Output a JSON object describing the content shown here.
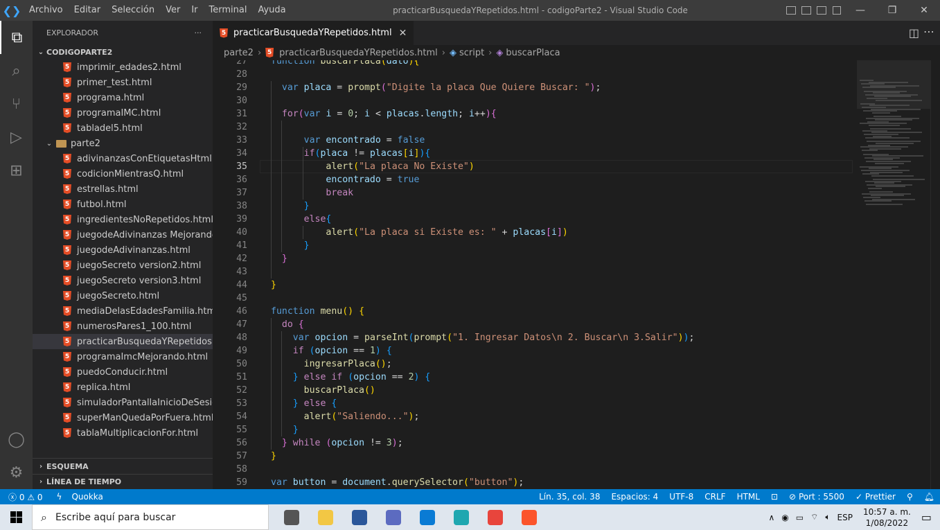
{
  "titlebar": {
    "menus": [
      "Archivo",
      "Editar",
      "Selección",
      "Ver",
      "Ir",
      "Terminal",
      "Ayuda"
    ],
    "title": "practicarBusquedaYRepetidos.html - codigoParte2 - Visual Studio Code",
    "minimize": "—",
    "restore": "❐",
    "close": "✕"
  },
  "activity": [
    {
      "name": "explorer-icon",
      "glyph": "⧉"
    },
    {
      "name": "search-icon",
      "glyph": "⌕"
    },
    {
      "name": "source-control-icon",
      "glyph": "⑂"
    },
    {
      "name": "run-debug-icon",
      "glyph": "▷"
    },
    {
      "name": "extensions-icon",
      "glyph": "⊞"
    }
  ],
  "activity_bottom": [
    {
      "name": "account-icon",
      "glyph": "◯"
    },
    {
      "name": "settings-gear-icon",
      "glyph": "⚙"
    }
  ],
  "sidebar": {
    "title": "EXPLORADOR",
    "more": "···",
    "root": "CODIGOPARTE2",
    "files_before": [
      "imprimir_edades2.html",
      "primer_test.html",
      "programa.html",
      "programaIMC.html",
      "tabladel5.html"
    ],
    "folder": "parte2",
    "files": [
      "adivinanzasConEtiquetasHtml.ht...",
      "codicionMientrasQ.html",
      "estrellas.html",
      "futbol.html",
      "ingredientesNoRepetidos.html",
      "juegodeAdivinanzas Mejorando....",
      "juegodeAdivinanzas.html",
      "juegoSecreto version2.html",
      "juegoSecreto version3.html",
      "juegoSecreto.html",
      "mediaDelasEdadesFamilia.html",
      "numerosPares1_100.html",
      "practicarBusquedaYRepetidos.ht...",
      "programaImcMejorando.html",
      "puedoConducir.html",
      "replica.html",
      "simuladorPantallaInicioDeSesion...",
      "superManQuedaPorFuera.html",
      "tablaMultiplicacionFor.html"
    ],
    "selected_index": 12,
    "outline": "ESQUEMA",
    "timeline": "LÍNEA DE TIEMPO"
  },
  "tab": {
    "label": "practicarBusquedaYRepetidos.html",
    "close": "✕"
  },
  "breadcrumb": {
    "folder": "parte2",
    "file": "practicarBusquedaYRepetidos.html",
    "symbol1": "script",
    "symbol2": "buscarPlaca"
  },
  "editor": {
    "first_line": 27,
    "current_line": 35,
    "lines": [
      [
        [
          "k",
          "function "
        ],
        [
          "f",
          "buscarPlaca"
        ],
        [
          "b1",
          "("
        ],
        [
          "v",
          "dato"
        ],
        [
          "b1",
          ")"
        ],
        [
          "b1",
          "{"
        ]
      ],
      [],
      [
        [
          "t",
          "  "
        ],
        [
          "k",
          "var "
        ],
        [
          "v",
          "placa"
        ],
        [
          "t",
          " = "
        ],
        [
          "f",
          "prompt"
        ],
        [
          "b2",
          "("
        ],
        [
          "s",
          "\"Digite la placa Que Quiere Buscar: \""
        ],
        [
          "b2",
          ")"
        ],
        [
          "t",
          ";"
        ]
      ],
      [],
      [
        [
          "t",
          "  "
        ],
        [
          "c",
          "for"
        ],
        [
          "b2",
          "("
        ],
        [
          "k",
          "var "
        ],
        [
          "v",
          "i"
        ],
        [
          "t",
          " = "
        ],
        [
          "n",
          "0"
        ],
        [
          "t",
          "; "
        ],
        [
          "v",
          "i"
        ],
        [
          "t",
          " < "
        ],
        [
          "v",
          "placas"
        ],
        [
          "t",
          "."
        ],
        [
          "v",
          "length"
        ],
        [
          "t",
          "; "
        ],
        [
          "v",
          "i"
        ],
        [
          "t",
          "++"
        ],
        [
          "b2",
          ")"
        ],
        [
          "b2",
          "{"
        ]
      ],
      [],
      [
        [
          "t",
          "      "
        ],
        [
          "k",
          "var "
        ],
        [
          "v",
          "encontrado"
        ],
        [
          "t",
          " = "
        ],
        [
          "k",
          "false"
        ]
      ],
      [
        [
          "t",
          "      "
        ],
        [
          "c",
          "if"
        ],
        [
          "b3",
          "("
        ],
        [
          "v",
          "placa"
        ],
        [
          "t",
          " != "
        ],
        [
          "v",
          "placas"
        ],
        [
          "b1",
          "["
        ],
        [
          "v",
          "i"
        ],
        [
          "b1",
          "]"
        ],
        [
          "b3",
          ")"
        ],
        [
          "b3",
          "{"
        ]
      ],
      [
        [
          "t",
          "          "
        ],
        [
          "f",
          "alert"
        ],
        [
          "b1",
          "("
        ],
        [
          "s",
          "\"La placa No Existe\""
        ],
        [
          "b1",
          ")"
        ]
      ],
      [
        [
          "t",
          "          "
        ],
        [
          "v",
          "encontrado"
        ],
        [
          "t",
          " = "
        ],
        [
          "k",
          "true"
        ]
      ],
      [
        [
          "t",
          "          "
        ],
        [
          "c",
          "break"
        ]
      ],
      [
        [
          "t",
          "      "
        ],
        [
          "b3",
          "}"
        ]
      ],
      [
        [
          "t",
          "      "
        ],
        [
          "c",
          "else"
        ],
        [
          "b3",
          "{"
        ]
      ],
      [
        [
          "t",
          "          "
        ],
        [
          "f",
          "alert"
        ],
        [
          "b1",
          "("
        ],
        [
          "s",
          "\"La placa si Existe es: \""
        ],
        [
          "t",
          " + "
        ],
        [
          "v",
          "placas"
        ],
        [
          "b2",
          "["
        ],
        [
          "v",
          "i"
        ],
        [
          "b2",
          "]"
        ],
        [
          "b1",
          ")"
        ]
      ],
      [
        [
          "t",
          "      "
        ],
        [
          "b3",
          "}"
        ]
      ],
      [
        [
          "t",
          "  "
        ],
        [
          "b2",
          "}"
        ]
      ],
      [],
      [
        [
          "b1",
          "}"
        ]
      ],
      [],
      [
        [
          "k",
          "function "
        ],
        [
          "f",
          "menu"
        ],
        [
          "b1",
          "()"
        ],
        [
          "t",
          " "
        ],
        [
          "b1",
          "{"
        ]
      ],
      [
        [
          "t",
          "  "
        ],
        [
          "c",
          "do "
        ],
        [
          "b2",
          "{"
        ]
      ],
      [
        [
          "t",
          "    "
        ],
        [
          "k",
          "var "
        ],
        [
          "v",
          "opcion"
        ],
        [
          "t",
          " = "
        ],
        [
          "f",
          "parseInt"
        ],
        [
          "b3",
          "("
        ],
        [
          "f",
          "prompt"
        ],
        [
          "b1",
          "("
        ],
        [
          "s",
          "\"1. Ingresar Datos\\n 2. Buscar\\n 3.Salir\""
        ],
        [
          "b1",
          ")"
        ],
        [
          "b3",
          ")"
        ],
        [
          "t",
          ";"
        ]
      ],
      [
        [
          "t",
          "    "
        ],
        [
          "c",
          "if "
        ],
        [
          "b3",
          "("
        ],
        [
          "v",
          "opcion"
        ],
        [
          "t",
          " == "
        ],
        [
          "n",
          "1"
        ],
        [
          "b3",
          ")"
        ],
        [
          "t",
          " "
        ],
        [
          "b3",
          "{"
        ]
      ],
      [
        [
          "t",
          "      "
        ],
        [
          "f",
          "ingresarPlaca"
        ],
        [
          "b1",
          "()"
        ],
        [
          "t",
          ";"
        ]
      ],
      [
        [
          "t",
          "    "
        ],
        [
          "b3",
          "}"
        ],
        [
          "t",
          " "
        ],
        [
          "c",
          "else if "
        ],
        [
          "b3",
          "("
        ],
        [
          "v",
          "opcion"
        ],
        [
          "t",
          " == "
        ],
        [
          "n",
          "2"
        ],
        [
          "b3",
          ")"
        ],
        [
          "t",
          " "
        ],
        [
          "b3",
          "{"
        ]
      ],
      [
        [
          "t",
          "      "
        ],
        [
          "f",
          "buscarPlaca"
        ],
        [
          "b1",
          "()"
        ]
      ],
      [
        [
          "t",
          "    "
        ],
        [
          "b3",
          "}"
        ],
        [
          "t",
          " "
        ],
        [
          "c",
          "else "
        ],
        [
          "b3",
          "{"
        ]
      ],
      [
        [
          "t",
          "      "
        ],
        [
          "f",
          "alert"
        ],
        [
          "b1",
          "("
        ],
        [
          "s",
          "\"Saliendo...\""
        ],
        [
          "b1",
          ")"
        ],
        [
          "t",
          ";"
        ]
      ],
      [
        [
          "t",
          "    "
        ],
        [
          "b3",
          "}"
        ]
      ],
      [
        [
          "t",
          "  "
        ],
        [
          "b2",
          "}"
        ],
        [
          "t",
          " "
        ],
        [
          "c",
          "while "
        ],
        [
          "b2",
          "("
        ],
        [
          "v",
          "opcion"
        ],
        [
          "t",
          " != "
        ],
        [
          "n",
          "3"
        ],
        [
          "b2",
          ")"
        ],
        [
          "t",
          ";"
        ]
      ],
      [
        [
          "b1",
          "}"
        ]
      ],
      [],
      [
        [
          "k",
          "var "
        ],
        [
          "v",
          "button"
        ],
        [
          "t",
          " = "
        ],
        [
          "v",
          "document"
        ],
        [
          "t",
          "."
        ],
        [
          "f",
          "querySelector"
        ],
        [
          "b1",
          "("
        ],
        [
          "s",
          "\"button\""
        ],
        [
          "b1",
          ")"
        ],
        [
          "t",
          ";"
        ]
      ]
    ]
  },
  "status": {
    "errors": "0",
    "warnings": "0",
    "quokka": "Quokka",
    "position": "Lín. 35, col. 38",
    "spaces": "Espacios: 4",
    "encoding": "UTF-8",
    "eol": "CRLF",
    "language": "HTML",
    "port": "Port : 5500",
    "prettier": "Prettier"
  },
  "taskbar": {
    "search_placeholder": "Escribe aquí para buscar",
    "lang": "ESP",
    "time": "10:57 a. m.",
    "date": "1/08/2022",
    "apps": [
      {
        "name": "task-view-icon",
        "color": "#555"
      },
      {
        "name": "file-explorer-icon",
        "color": "#f2c744"
      },
      {
        "name": "word-icon",
        "color": "#2b579a"
      },
      {
        "name": "office-icon",
        "color": "#5c6bc0"
      },
      {
        "name": "vscode-icon",
        "color": "#0a7bd4"
      },
      {
        "name": "edge-icon",
        "color": "#1fa7b0"
      },
      {
        "name": "chrome-icon",
        "color": "#e8453c"
      },
      {
        "name": "brave-icon",
        "color": "#fb542b"
      }
    ]
  }
}
